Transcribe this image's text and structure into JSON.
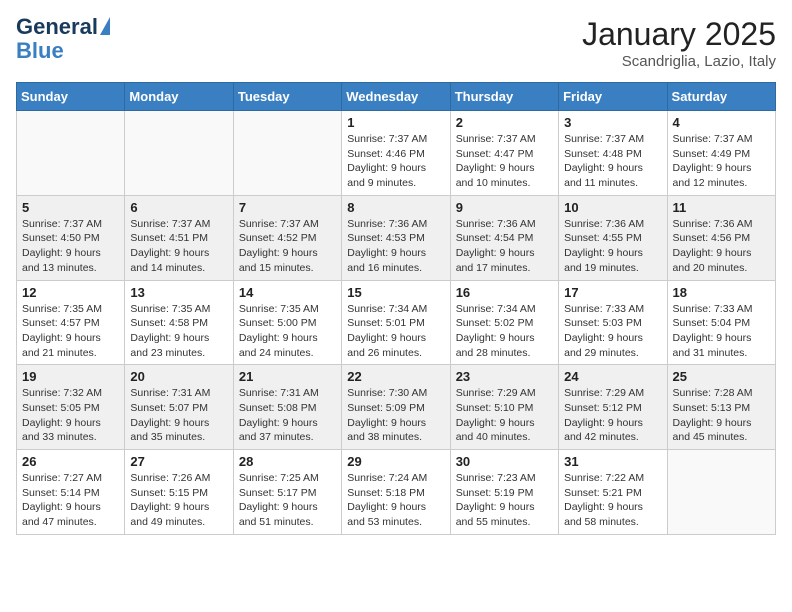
{
  "header": {
    "logo_general": "General",
    "logo_blue": "Blue",
    "month": "January 2025",
    "location": "Scandriglia, Lazio, Italy"
  },
  "days_of_week": [
    "Sunday",
    "Monday",
    "Tuesday",
    "Wednesday",
    "Thursday",
    "Friday",
    "Saturday"
  ],
  "weeks": [
    [
      {
        "day": "",
        "sunrise": "",
        "sunset": "",
        "daylight": ""
      },
      {
        "day": "",
        "sunrise": "",
        "sunset": "",
        "daylight": ""
      },
      {
        "day": "",
        "sunrise": "",
        "sunset": "",
        "daylight": ""
      },
      {
        "day": "1",
        "sunrise": "Sunrise: 7:37 AM",
        "sunset": "Sunset: 4:46 PM",
        "daylight": "Daylight: 9 hours and 9 minutes."
      },
      {
        "day": "2",
        "sunrise": "Sunrise: 7:37 AM",
        "sunset": "Sunset: 4:47 PM",
        "daylight": "Daylight: 9 hours and 10 minutes."
      },
      {
        "day": "3",
        "sunrise": "Sunrise: 7:37 AM",
        "sunset": "Sunset: 4:48 PM",
        "daylight": "Daylight: 9 hours and 11 minutes."
      },
      {
        "day": "4",
        "sunrise": "Sunrise: 7:37 AM",
        "sunset": "Sunset: 4:49 PM",
        "daylight": "Daylight: 9 hours and 12 minutes."
      }
    ],
    [
      {
        "day": "5",
        "sunrise": "Sunrise: 7:37 AM",
        "sunset": "Sunset: 4:50 PM",
        "daylight": "Daylight: 9 hours and 13 minutes."
      },
      {
        "day": "6",
        "sunrise": "Sunrise: 7:37 AM",
        "sunset": "Sunset: 4:51 PM",
        "daylight": "Daylight: 9 hours and 14 minutes."
      },
      {
        "day": "7",
        "sunrise": "Sunrise: 7:37 AM",
        "sunset": "Sunset: 4:52 PM",
        "daylight": "Daylight: 9 hours and 15 minutes."
      },
      {
        "day": "8",
        "sunrise": "Sunrise: 7:36 AM",
        "sunset": "Sunset: 4:53 PM",
        "daylight": "Daylight: 9 hours and 16 minutes."
      },
      {
        "day": "9",
        "sunrise": "Sunrise: 7:36 AM",
        "sunset": "Sunset: 4:54 PM",
        "daylight": "Daylight: 9 hours and 17 minutes."
      },
      {
        "day": "10",
        "sunrise": "Sunrise: 7:36 AM",
        "sunset": "Sunset: 4:55 PM",
        "daylight": "Daylight: 9 hours and 19 minutes."
      },
      {
        "day": "11",
        "sunrise": "Sunrise: 7:36 AM",
        "sunset": "Sunset: 4:56 PM",
        "daylight": "Daylight: 9 hours and 20 minutes."
      }
    ],
    [
      {
        "day": "12",
        "sunrise": "Sunrise: 7:35 AM",
        "sunset": "Sunset: 4:57 PM",
        "daylight": "Daylight: 9 hours and 21 minutes."
      },
      {
        "day": "13",
        "sunrise": "Sunrise: 7:35 AM",
        "sunset": "Sunset: 4:58 PM",
        "daylight": "Daylight: 9 hours and 23 minutes."
      },
      {
        "day": "14",
        "sunrise": "Sunrise: 7:35 AM",
        "sunset": "Sunset: 5:00 PM",
        "daylight": "Daylight: 9 hours and 24 minutes."
      },
      {
        "day": "15",
        "sunrise": "Sunrise: 7:34 AM",
        "sunset": "Sunset: 5:01 PM",
        "daylight": "Daylight: 9 hours and 26 minutes."
      },
      {
        "day": "16",
        "sunrise": "Sunrise: 7:34 AM",
        "sunset": "Sunset: 5:02 PM",
        "daylight": "Daylight: 9 hours and 28 minutes."
      },
      {
        "day": "17",
        "sunrise": "Sunrise: 7:33 AM",
        "sunset": "Sunset: 5:03 PM",
        "daylight": "Daylight: 9 hours and 29 minutes."
      },
      {
        "day": "18",
        "sunrise": "Sunrise: 7:33 AM",
        "sunset": "Sunset: 5:04 PM",
        "daylight": "Daylight: 9 hours and 31 minutes."
      }
    ],
    [
      {
        "day": "19",
        "sunrise": "Sunrise: 7:32 AM",
        "sunset": "Sunset: 5:05 PM",
        "daylight": "Daylight: 9 hours and 33 minutes."
      },
      {
        "day": "20",
        "sunrise": "Sunrise: 7:31 AM",
        "sunset": "Sunset: 5:07 PM",
        "daylight": "Daylight: 9 hours and 35 minutes."
      },
      {
        "day": "21",
        "sunrise": "Sunrise: 7:31 AM",
        "sunset": "Sunset: 5:08 PM",
        "daylight": "Daylight: 9 hours and 37 minutes."
      },
      {
        "day": "22",
        "sunrise": "Sunrise: 7:30 AM",
        "sunset": "Sunset: 5:09 PM",
        "daylight": "Daylight: 9 hours and 38 minutes."
      },
      {
        "day": "23",
        "sunrise": "Sunrise: 7:29 AM",
        "sunset": "Sunset: 5:10 PM",
        "daylight": "Daylight: 9 hours and 40 minutes."
      },
      {
        "day": "24",
        "sunrise": "Sunrise: 7:29 AM",
        "sunset": "Sunset: 5:12 PM",
        "daylight": "Daylight: 9 hours and 42 minutes."
      },
      {
        "day": "25",
        "sunrise": "Sunrise: 7:28 AM",
        "sunset": "Sunset: 5:13 PM",
        "daylight": "Daylight: 9 hours and 45 minutes."
      }
    ],
    [
      {
        "day": "26",
        "sunrise": "Sunrise: 7:27 AM",
        "sunset": "Sunset: 5:14 PM",
        "daylight": "Daylight: 9 hours and 47 minutes."
      },
      {
        "day": "27",
        "sunrise": "Sunrise: 7:26 AM",
        "sunset": "Sunset: 5:15 PM",
        "daylight": "Daylight: 9 hours and 49 minutes."
      },
      {
        "day": "28",
        "sunrise": "Sunrise: 7:25 AM",
        "sunset": "Sunset: 5:17 PM",
        "daylight": "Daylight: 9 hours and 51 minutes."
      },
      {
        "day": "29",
        "sunrise": "Sunrise: 7:24 AM",
        "sunset": "Sunset: 5:18 PM",
        "daylight": "Daylight: 9 hours and 53 minutes."
      },
      {
        "day": "30",
        "sunrise": "Sunrise: 7:23 AM",
        "sunset": "Sunset: 5:19 PM",
        "daylight": "Daylight: 9 hours and 55 minutes."
      },
      {
        "day": "31",
        "sunrise": "Sunrise: 7:22 AM",
        "sunset": "Sunset: 5:21 PM",
        "daylight": "Daylight: 9 hours and 58 minutes."
      },
      {
        "day": "",
        "sunrise": "",
        "sunset": "",
        "daylight": ""
      }
    ]
  ]
}
